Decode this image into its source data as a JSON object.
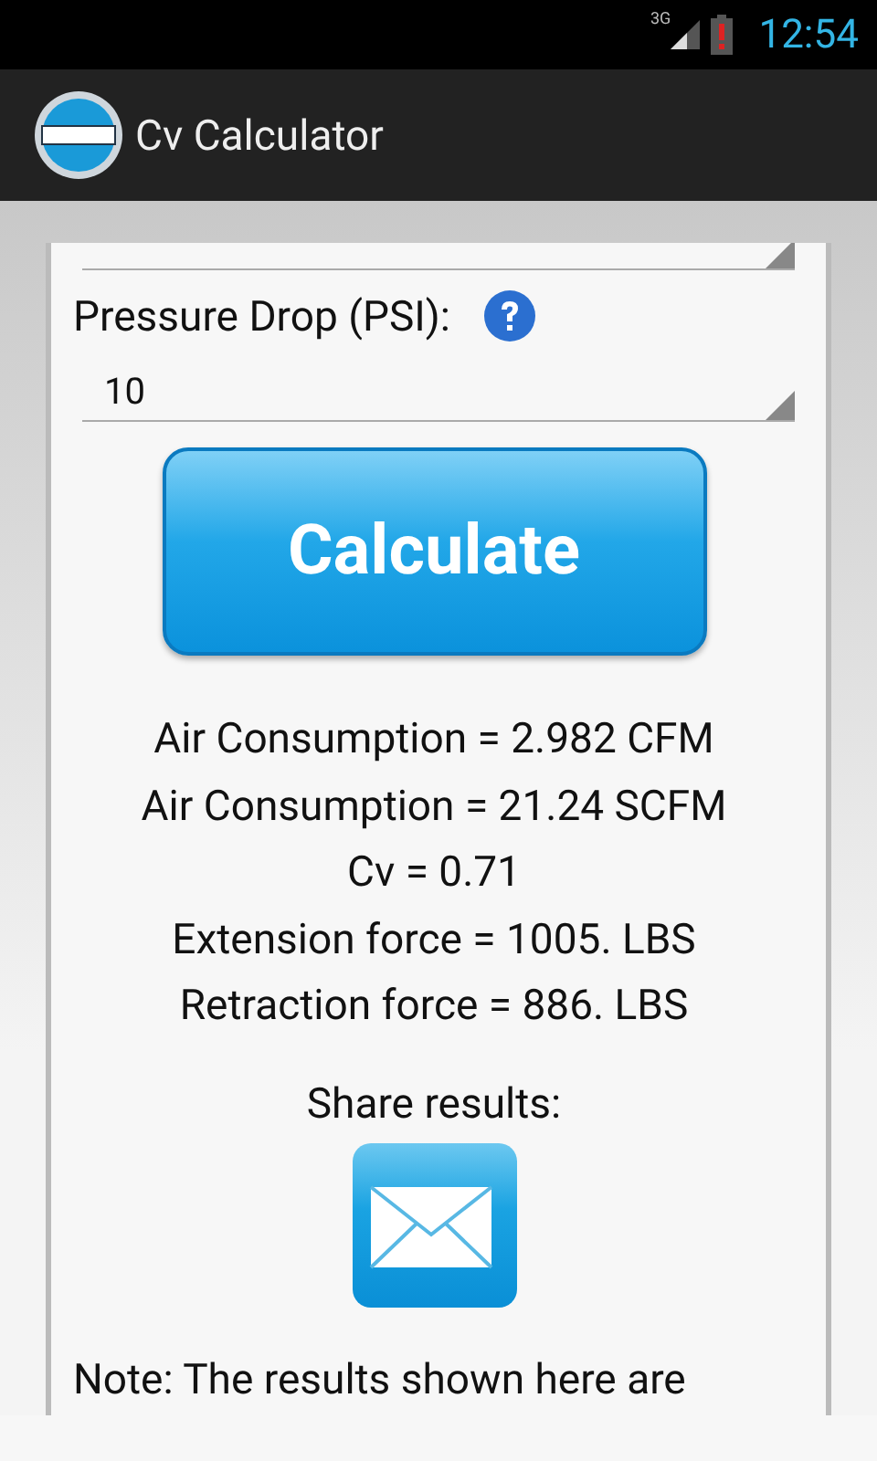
{
  "status_bar": {
    "network": "3G",
    "time": "12:54"
  },
  "action_bar": {
    "title": "Cv Calculator"
  },
  "form": {
    "pressure_label": "Pressure Drop (PSI):",
    "pressure_value": "10"
  },
  "calculate_button": "Calculate",
  "results": [
    "Air Consumption = 2.982 CFM",
    "Air Consumption = 21.24 SCFM",
    "Cv = 0.71",
    "Extension force = 1005. LBS",
    "Retraction force = 886. LBS"
  ],
  "share_label": "Share results:",
  "note": "Note: The results shown here are"
}
